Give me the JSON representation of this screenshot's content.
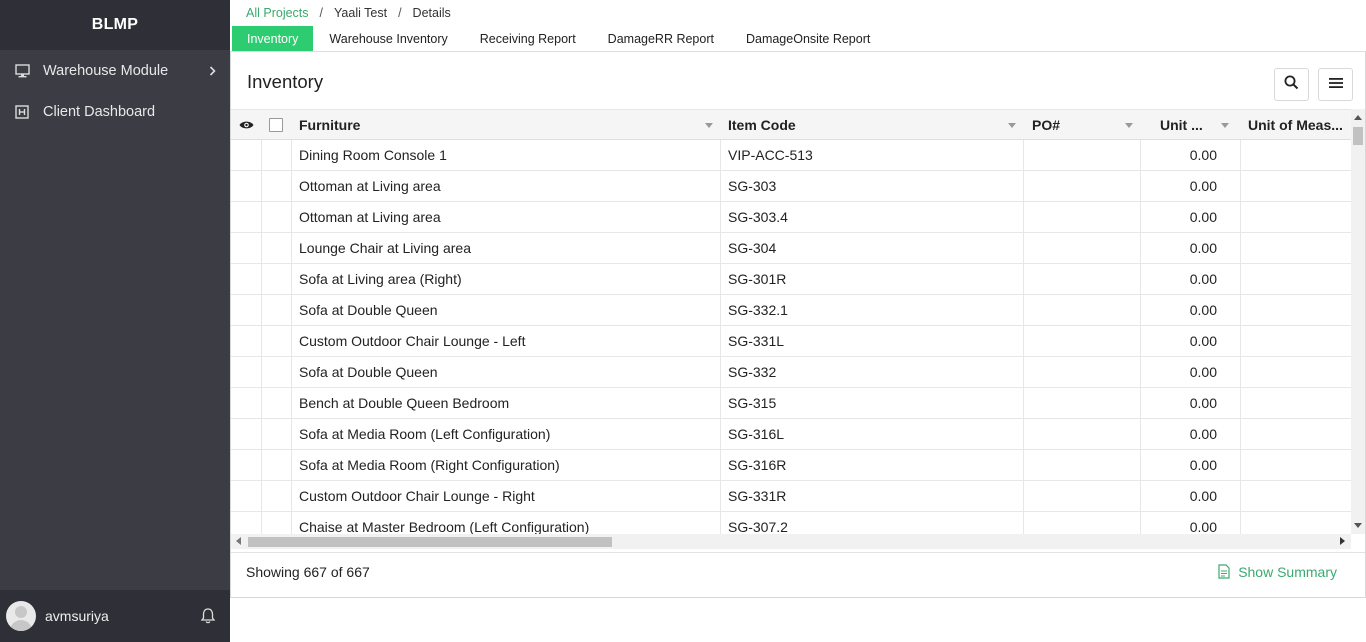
{
  "sidebar": {
    "brand": "BLMP",
    "items": [
      {
        "label": "Warehouse Module",
        "icon": "monitor-icon"
      },
      {
        "label": "Client Dashboard",
        "icon": "dashboard-icon"
      }
    ],
    "user": {
      "name": "avmsuriya"
    }
  },
  "breadcrumb": {
    "items": [
      "All Projects",
      "Yaali Test",
      "Details"
    ],
    "separator": "/"
  },
  "tabs": [
    "Inventory",
    "Warehouse Inventory",
    "Receiving Report",
    "DamageRR Report",
    "DamageOnsite Report"
  ],
  "active_tab": "Inventory",
  "panel": {
    "title": "Inventory"
  },
  "grid": {
    "columns": [
      "Furniture",
      "Item Code",
      "PO#",
      "Unit ...",
      "Unit of Meas..."
    ],
    "rows": [
      {
        "furniture": "Dining Room Console 1",
        "item_code": "VIP-ACC-513",
        "po": "",
        "unit": "0.00",
        "uom": ""
      },
      {
        "furniture": "Ottoman at Living area",
        "item_code": "SG-303",
        "po": "",
        "unit": "0.00",
        "uom": ""
      },
      {
        "furniture": "Ottoman at Living area",
        "item_code": "SG-303.4",
        "po": "",
        "unit": "0.00",
        "uom": ""
      },
      {
        "furniture": "Lounge Chair at Living area",
        "item_code": "SG-304",
        "po": "",
        "unit": "0.00",
        "uom": ""
      },
      {
        "furniture": "Sofa at Living area (Right)",
        "item_code": "SG-301R",
        "po": "",
        "unit": "0.00",
        "uom": ""
      },
      {
        "furniture": "Sofa at Double Queen",
        "item_code": "SG-332.1",
        "po": "",
        "unit": "0.00",
        "uom": ""
      },
      {
        "furniture": "Custom Outdoor Chair Lounge - Left",
        "item_code": "SG-331L",
        "po": "",
        "unit": "0.00",
        "uom": ""
      },
      {
        "furniture": "Sofa at Double Queen",
        "item_code": "SG-332",
        "po": "",
        "unit": "0.00",
        "uom": ""
      },
      {
        "furniture": "Bench at Double Queen Bedroom",
        "item_code": "SG-315",
        "po": "",
        "unit": "0.00",
        "uom": ""
      },
      {
        "furniture": "Sofa at Media Room (Left Configuration)",
        "item_code": "SG-316L",
        "po": "",
        "unit": "0.00",
        "uom": ""
      },
      {
        "furniture": "Sofa at Media Room (Right Configuration)",
        "item_code": "SG-316R",
        "po": "",
        "unit": "0.00",
        "uom": ""
      },
      {
        "furniture": "Custom Outdoor Chair Lounge - Right",
        "item_code": "SG-331R",
        "po": "",
        "unit": "0.00",
        "uom": ""
      },
      {
        "furniture": "Chaise at Master Bedroom (Left Configuration)",
        "item_code": "SG-307.2",
        "po": "",
        "unit": "0.00",
        "uom": ""
      }
    ]
  },
  "footer": {
    "showing": "Showing 667 of 667",
    "summary_label": "Show Summary"
  },
  "colors": {
    "accent": "#2ecc71",
    "link": "#3aaa6f",
    "sidebar_bg": "#3b3c44",
    "sidebar_dark": "#2f3037"
  }
}
